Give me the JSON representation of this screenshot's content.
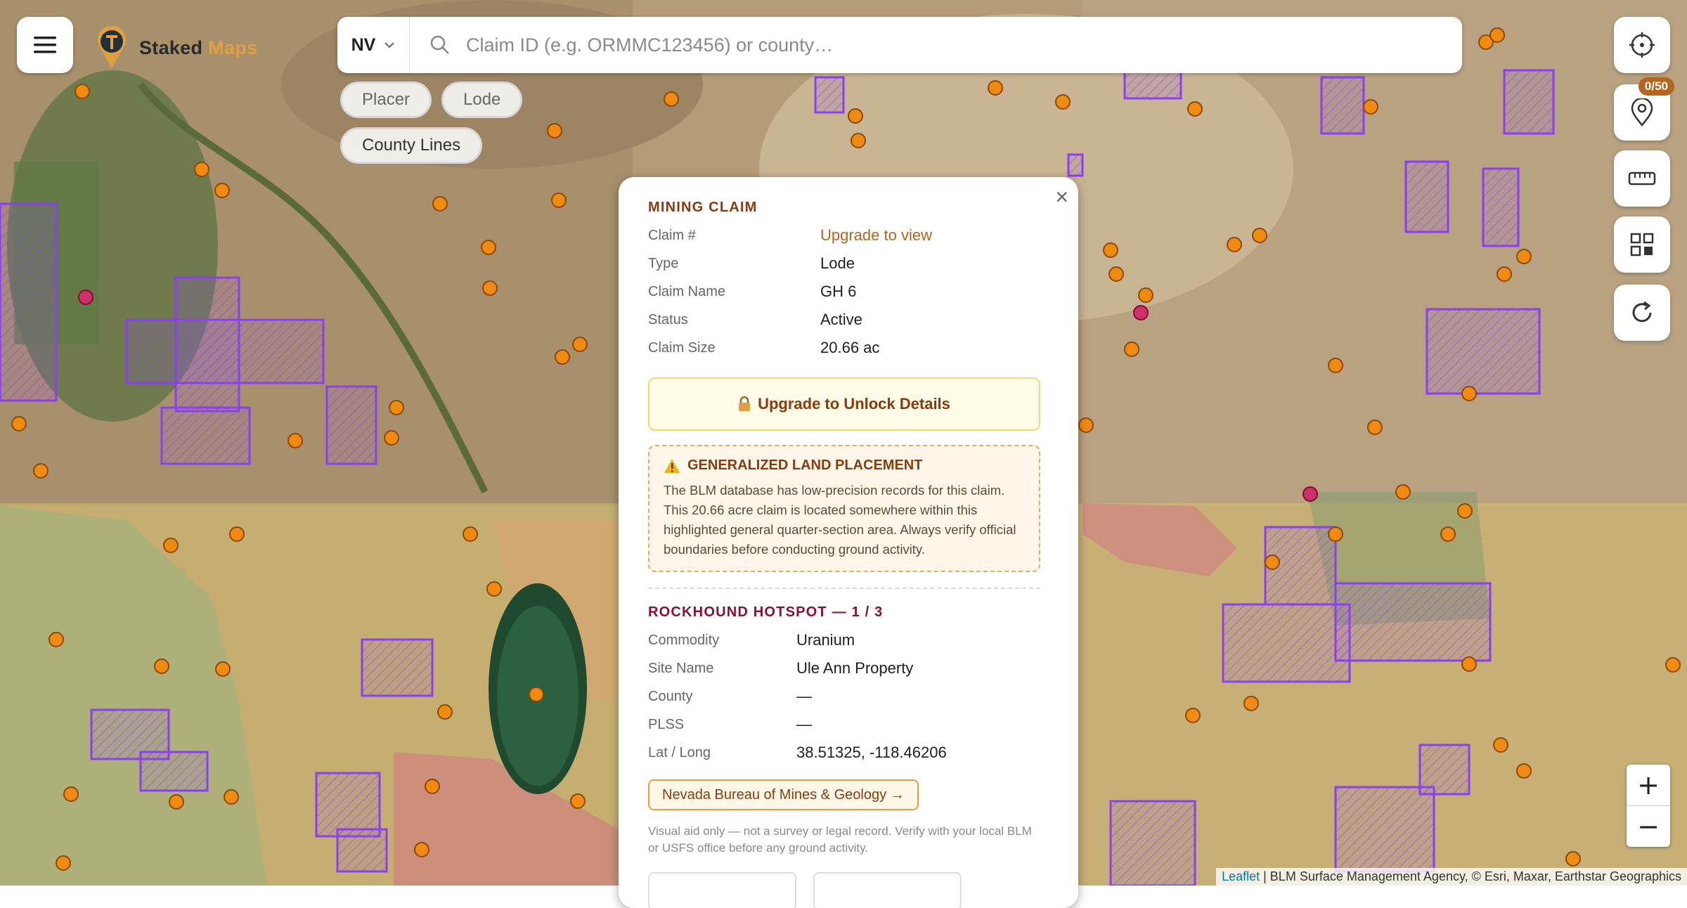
{
  "app": {
    "brand_main": "Staked",
    "brand_accent": "Maps"
  },
  "search": {
    "state": "NV",
    "placeholder": "Claim ID (e.g. ORMMC123456) or county…"
  },
  "filters": {
    "placer": "Placer",
    "lode": "Lode",
    "county_lines": "County Lines"
  },
  "tools": {
    "pin_counter": "0/50"
  },
  "zoom": {
    "in": "+",
    "out": "−"
  },
  "attribution": {
    "leaflet": "Leaflet",
    "text": " | BLM Surface Management Agency, © Esri, Maxar, Earthstar Geographics"
  },
  "popup": {
    "close": "×",
    "claim": {
      "title": "MINING CLAIM",
      "rows": [
        {
          "label": "Claim #",
          "value": "Upgrade to view"
        },
        {
          "label": "Type",
          "value": "Lode"
        },
        {
          "label": "Claim Name",
          "value": "GH 6"
        },
        {
          "label": "Status",
          "value": "Active"
        },
        {
          "label": "Claim Size",
          "value": "20.66 ac"
        }
      ]
    },
    "unlock_button": "Upgrade to Unlock Details",
    "generalized": {
      "title": "GENERALIZED LAND PLACEMENT",
      "body": "The BLM database has low-precision records for this claim. This 20.66 acre claim is located somewhere within this highlighted general quarter-section area. Always verify official boundaries before conducting ground activity."
    },
    "hotspot": {
      "title": "ROCKHOUND HOTSPOT — 1 / 3",
      "rows": [
        {
          "label": "Commodity",
          "value": "Uranium"
        },
        {
          "label": "Site Name",
          "value": "Ule Ann Property"
        },
        {
          "label": "County",
          "value": "—"
        },
        {
          "label": "PLSS",
          "value": "—"
        },
        {
          "label": "Lat / Long",
          "value": "38.51325, -118.46206"
        }
      ]
    },
    "nbmg_link": "Nevada Bureau of Mines & Geology →",
    "disclaimer": "Visual aid only — not a survey or legal record. Verify with your local BLM or USFS office before any ground activity."
  },
  "colors": {
    "claim_outline": "#8a3ff0",
    "hotspot_dot": "#f08a10",
    "uranium_dot": "#d0306a",
    "accent": "#b5651d"
  }
}
